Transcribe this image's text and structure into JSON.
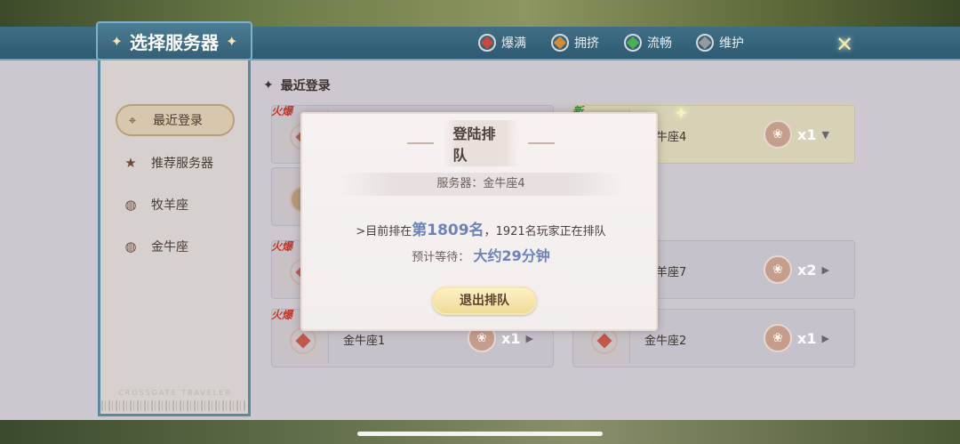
{
  "header": {
    "title": "选择服务器",
    "legend": [
      {
        "label": "爆满",
        "color": "#c94a3c"
      },
      {
        "label": "拥挤",
        "color": "#d38a3a"
      },
      {
        "label": "流畅",
        "color": "#4caf50"
      },
      {
        "label": "维护",
        "color": "#9a9a9a"
      }
    ]
  },
  "sidebar": {
    "items": [
      {
        "label": "最近登录",
        "icon": "location-icon",
        "active": true
      },
      {
        "label": "推荐服务器",
        "icon": "star-icon"
      },
      {
        "label": "牧羊座",
        "icon": "globe-icon"
      },
      {
        "label": "金牛座",
        "icon": "globe-icon"
      }
    ],
    "footer": "CROSSGATE  TRAVELER"
  },
  "section": {
    "title": "最近登录"
  },
  "servers": [
    {
      "tag": "火爆",
      "name": "",
      "multiplier": ""
    },
    {
      "tag": "新",
      "name": "金牛座4",
      "multiplier": "x1"
    },
    {
      "tag": "",
      "name": "",
      "multiplier": ""
    },
    {
      "tag": "火爆",
      "name": "",
      "multiplier": ""
    },
    {
      "tag": "",
      "name": "牧羊座7",
      "multiplier": "x2"
    },
    {
      "tag": "火爆",
      "name": "金牛座1",
      "multiplier": "x1"
    },
    {
      "tag": "",
      "name": "金牛座2",
      "multiplier": "x1"
    }
  ],
  "popup": {
    "title": "登陆排队",
    "server": "服务器：金牛座4",
    "queue_prefix": ">目前排在",
    "queue_rank": "第1809名",
    "queue_suffix": "，1921名玩家正在排队",
    "wait_label": "预计等待：",
    "wait_value": "大约29分钟",
    "exit_label": "退出排队"
  }
}
